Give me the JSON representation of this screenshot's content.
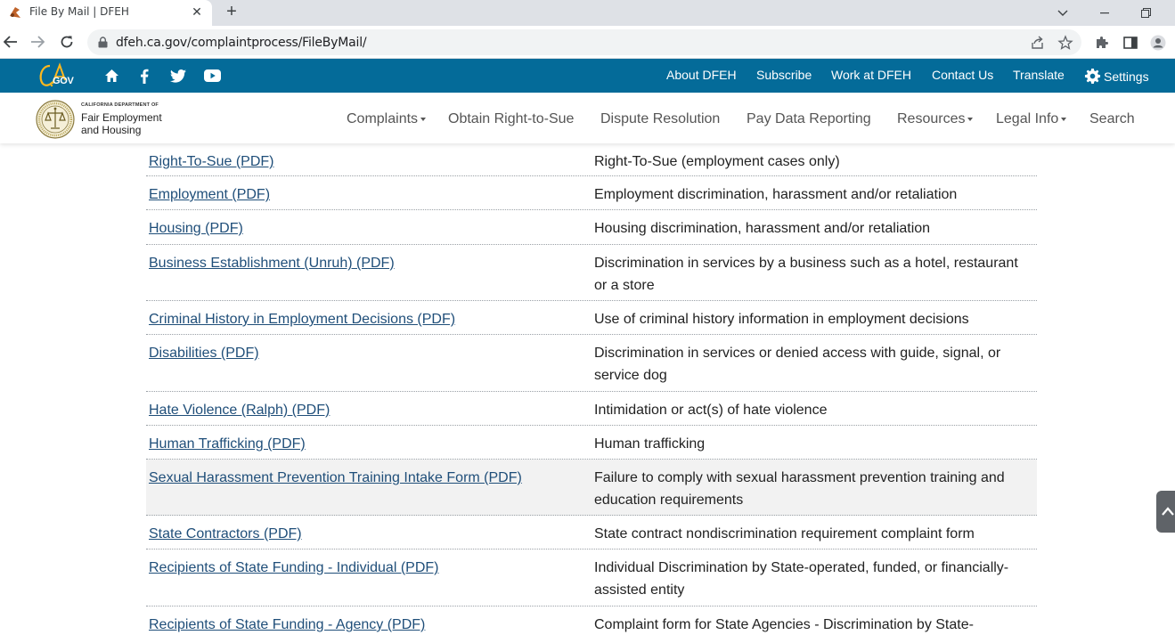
{
  "browser": {
    "tab_title": "File By Mail | DFEH",
    "tab_close": "✕",
    "newtab": "+",
    "url": "dfeh.ca.gov/complaintprocess/FileByMail/"
  },
  "cagov": {
    "logo_text": "GOV",
    "utility_links": [
      "About DFEH",
      "Subscribe",
      "Work at DFEH",
      "Contact Us",
      "Translate",
      "Settings"
    ]
  },
  "header": {
    "dept_line1": "CALIFORNIA DEPARTMENT OF",
    "dept_line2": "Fair Employment",
    "dept_line3": "and Housing",
    "nav": [
      "Complaints",
      "Obtain Right-to-Sue",
      "Dispute Resolution",
      "Pay Data Reporting",
      "Resources",
      "Legal Info",
      "Search"
    ]
  },
  "forms": [
    {
      "link": "Right-To-Sue (PDF)",
      "desc": "Right-To-Sue (employment cases only)"
    },
    {
      "link": "Employment (PDF)",
      "desc": "Employment discrimination, harassment and/or retaliation"
    },
    {
      "link": "Housing (PDF)",
      "desc": "Housing discrimination, harassment and/or retaliation"
    },
    {
      "link": "Business Establishment (Unruh) (PDF)",
      "desc": "Discrimination in services by a business such as a hotel, restaurant or a store"
    },
    {
      "link": "Criminal History in Employment Decisions (PDF)",
      "desc": "Use of criminal history information in employment decisions"
    },
    {
      "link": "Disabilities (PDF)",
      "desc": "Discrimination in services or denied access with guide, signal, or service dog"
    },
    {
      "link": "Hate Violence (Ralph) (PDF)",
      "desc": "Intimidation or act(s) of hate violence"
    },
    {
      "link": "Human Trafficking (PDF)",
      "desc": "Human trafficking"
    },
    {
      "link": "Sexual Harassment Prevention Training Intake Form (PDF)",
      "desc": "Failure to comply with sexual harassment prevention training and education requirements"
    },
    {
      "link": "State Contractors (PDF)",
      "desc": "State contract nondiscrimination requirement complaint form"
    },
    {
      "link": "Recipients of State Funding - Individual (PDF)",
      "desc": "Individual Discrimination by State-operated, funded, or financially-assisted entity"
    },
    {
      "link": "Recipients of State Funding - Agency (PDF)",
      "desc": "Complaint form for State Agencies - Discrimination by State-"
    }
  ],
  "colors": {
    "ca_bar": "#046b99",
    "link": "#1f4e79",
    "highlight_row": "#f2f2f2"
  }
}
